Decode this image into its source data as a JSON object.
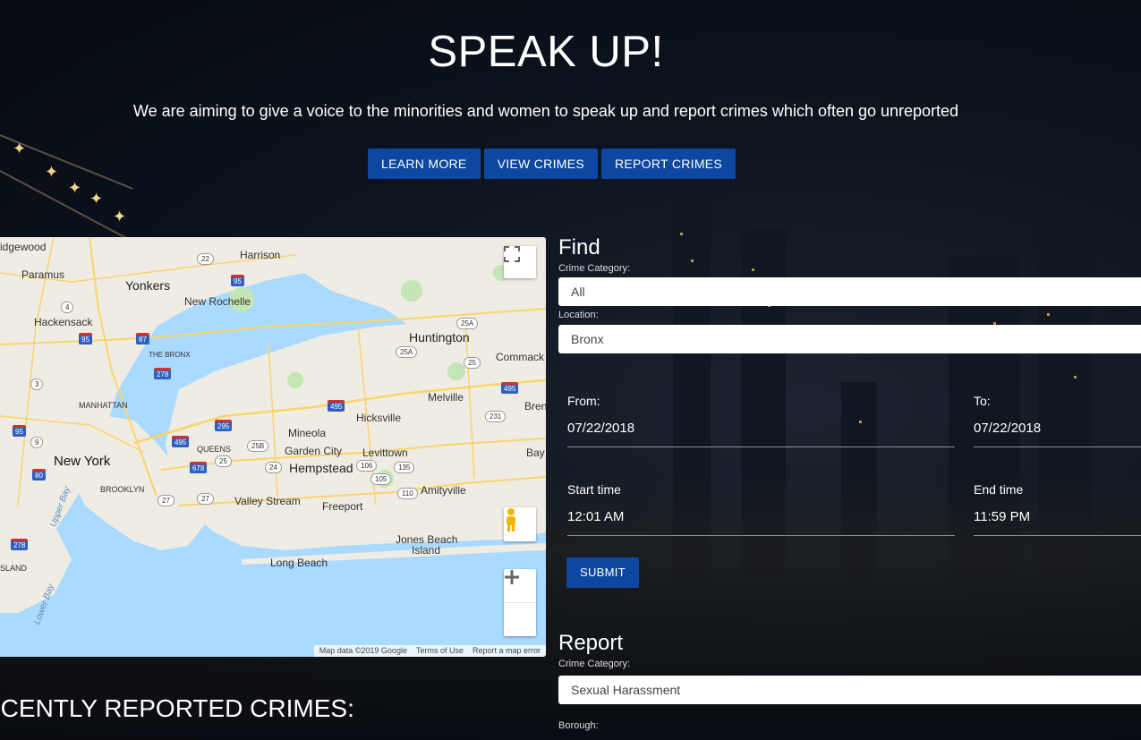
{
  "hero": {
    "title": "SPEAK UP!",
    "subtitle": "We are aiming to give a voice to the minorities and women to speak up and report crimes which often go unreported",
    "buttons": [
      "LEARN MORE",
      "VIEW CRIMES",
      "REPORT CRIMES"
    ]
  },
  "map": {
    "labels": {
      "ridgewood": "idgewood",
      "paramus": "Paramus",
      "yonkers": "Yonkers",
      "new_rochelle": "New Rochelle",
      "harrison": "Harrison",
      "hackensack": "Hackensack",
      "the_bronx": "THE BRONX",
      "manhattan": "MANHATTAN",
      "new_york": "New York",
      "brooklyn": "BROOKLYN",
      "queens": "QUEENS",
      "mineola": "Mineola",
      "garden_city": "Garden City",
      "hempstead": "Hempstead",
      "hicksville": "Hicksville",
      "levittown": "Levittown",
      "huntington": "Huntington",
      "commack": "Commack",
      "melville": "Melville",
      "valley_stream": "Valley Stream",
      "freeport": "Freeport",
      "amityville": "Amityville",
      "jones_beach": "Jones Beach",
      "island": "Island",
      "long_beach": "Long Beach",
      "bay": "Bay",
      "brent": "Brent",
      "sland": "SLAND",
      "upper_bay": "Upper Bay",
      "lower_bay": "Lower Bay"
    },
    "shields": [
      "95",
      "87",
      "278",
      "495",
      "295",
      "678",
      "95",
      "278",
      "22",
      "495",
      "80",
      "495"
    ],
    "ovals": [
      "22",
      "4",
      "3",
      "9",
      "25A",
      "25A",
      "25",
      "231",
      "25B",
      "25",
      "24",
      "106",
      "135",
      "105",
      "27",
      "27",
      "110"
    ],
    "footer": [
      "Map data ©2019 Google",
      "Terms of Use",
      "Report a map error"
    ]
  },
  "recent_title": "ECENTLY REPORTED CRIMES:",
  "find": {
    "title": "Find",
    "category_label": "Crime Category:",
    "category_value": "All",
    "location_label": "Location:",
    "location_value": "Bronx",
    "from_label": "From:",
    "from_value": "07/22/2018",
    "to_label": "To:",
    "to_value": "07/22/2018",
    "start_label": "Start time",
    "start_value": "12:01 AM",
    "end_label": "End time",
    "end_value": "11:59 PM",
    "submit": "SUBMIT"
  },
  "report": {
    "title": "Report",
    "category_label": "Crime Category:",
    "category_value": "Sexual Harassment",
    "borough_label": "Borough:"
  },
  "colors": {
    "button": "#0d47a1",
    "water": "#aadaff",
    "land": "#f0ede5",
    "road": "#fbd46b"
  }
}
